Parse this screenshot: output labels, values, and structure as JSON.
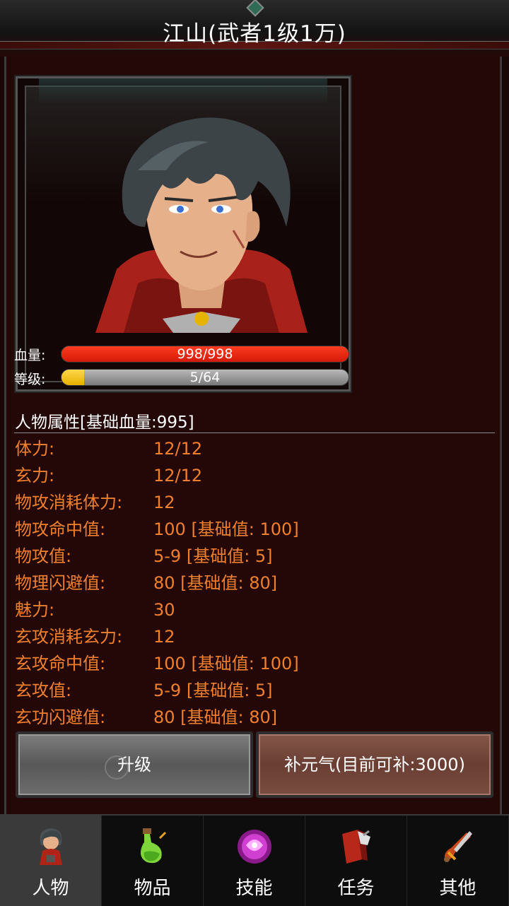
{
  "header": {
    "title": "江山(武者1级1万)"
  },
  "character": {
    "hp_label": "血量:",
    "hp_text": "998/998",
    "hp_fraction": 1.0,
    "level_label": "等级:",
    "level_text": "5/64",
    "level_fraction": 0.078
  },
  "attributes": {
    "title": "人物属性[基础血量:995]",
    "rows": [
      {
        "key": "体力:",
        "value": "12/12"
      },
      {
        "key": "玄力:",
        "value": "12/12"
      },
      {
        "key": "物攻消耗体力:",
        "value": "12"
      },
      {
        "key": "物攻命中值:",
        "value": "100 [基础值: 100]"
      },
      {
        "key": "物攻值:",
        "value": "5-9 [基础值: 5]"
      },
      {
        "key": "物理闪避值:",
        "value": "80 [基础值: 80]"
      },
      {
        "key": "魅力:",
        "value": "30"
      },
      {
        "key": "玄攻消耗玄力:",
        "value": "12"
      },
      {
        "key": "玄攻命中值:",
        "value": "100 [基础值: 100]"
      },
      {
        "key": "玄攻值:",
        "value": "5-9 [基础值: 5]"
      },
      {
        "key": "玄功闪避值:",
        "value": "80 [基础值: 80]"
      }
    ]
  },
  "actions": {
    "upgrade_label": "升级",
    "restore_label": "补元气(目前可补:3000)"
  },
  "nav": {
    "items": [
      {
        "label": "人物",
        "icon": "character-icon",
        "active": true
      },
      {
        "label": "物品",
        "icon": "potion-icon",
        "active": false
      },
      {
        "label": "技能",
        "icon": "skill-orb-icon",
        "active": false
      },
      {
        "label": "任务",
        "icon": "quest-book-icon",
        "active": false
      },
      {
        "label": "其他",
        "icon": "sword-icon",
        "active": false
      }
    ]
  },
  "colors": {
    "attr_text": "#f0802c",
    "hp_fill": "#e0200c",
    "level_fill": "#f0c000",
    "nav_active": "#3a3a3a"
  }
}
